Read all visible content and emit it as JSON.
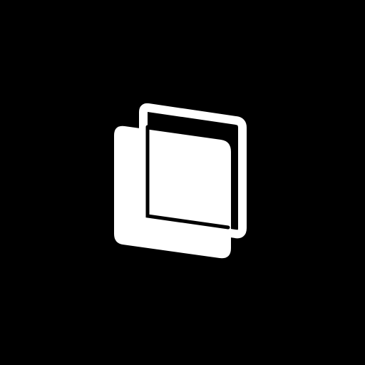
{
  "logo": {
    "icon": "stacked-panels-icon",
    "background_color": "#000000",
    "foreground_color": "#ffffff"
  }
}
